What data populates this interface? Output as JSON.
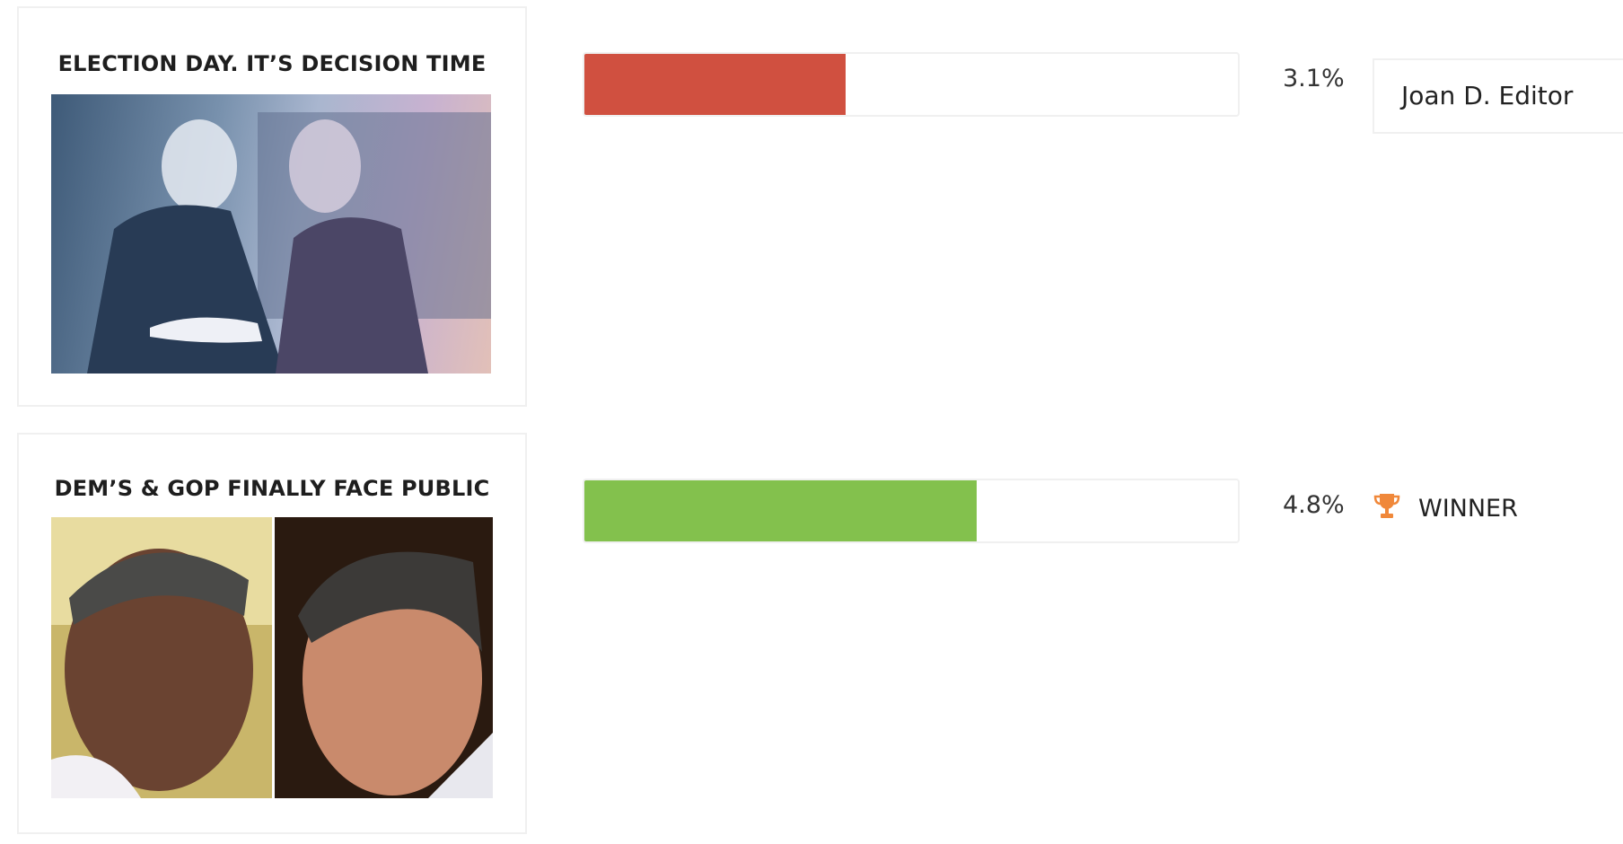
{
  "entries": [
    {
      "title": "ELECTION DAY. IT’S DECISION TIME",
      "image_alt": "Two candidates shaking hands on debate stage",
      "percent_text": "3.1%",
      "bar_fraction": 0.4,
      "bar_color": "#d05040",
      "author": "Joan D. Editor"
    },
    {
      "title": "DEM’S & GOP FINALLY FACE PUBLIC",
      "image_alt": "Side-by-side candidate portraits",
      "percent_text": "4.8%",
      "bar_fraction": 0.6,
      "bar_color": "#83c14d",
      "winner_label": "WINNER",
      "trophy_color": "#f0883a"
    }
  ]
}
